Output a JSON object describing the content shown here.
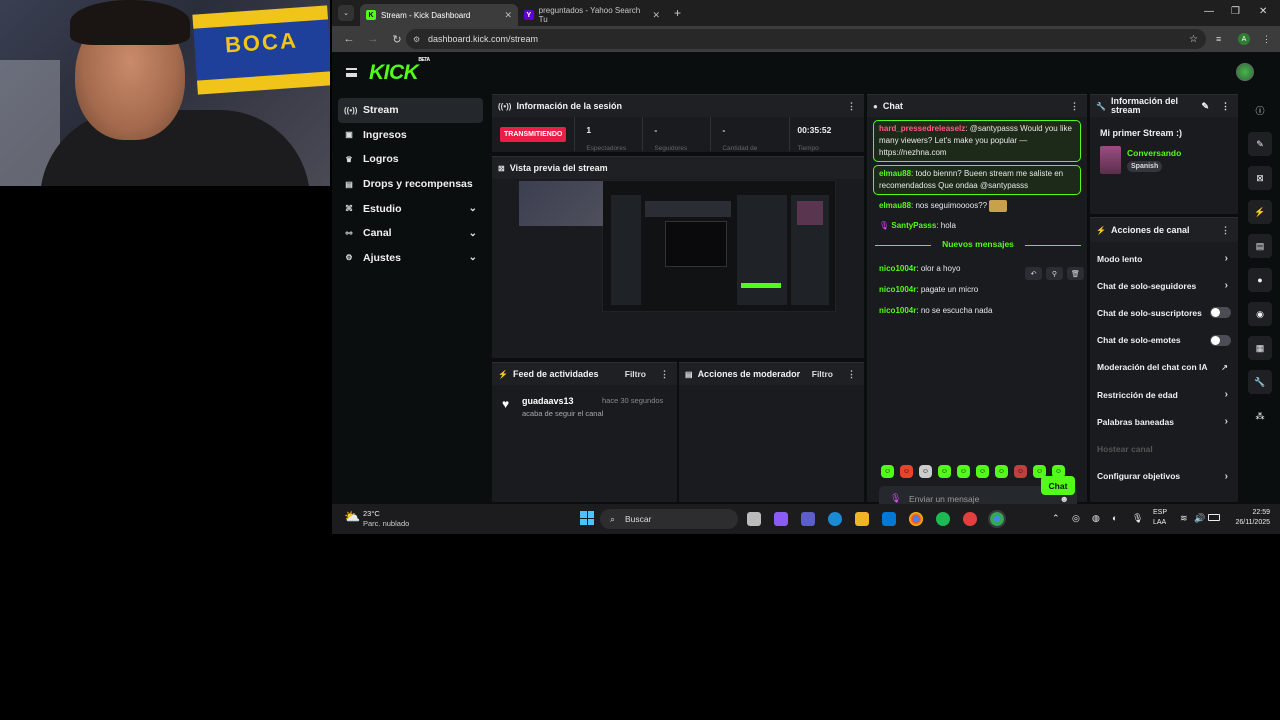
{
  "browser": {
    "tabs": [
      {
        "label": "Stream - Kick Dashboard",
        "icon": "kick-icon",
        "color": "#53fc18"
      },
      {
        "label": "preguntados - Yahoo Search Tu",
        "icon": "yahoo-icon",
        "color": "#6001d2"
      }
    ],
    "url": "dashboard.kick.com/stream",
    "profile_initial": "A"
  },
  "kick": {
    "logo": "KICK",
    "logo_badge": "BETA",
    "accent": "#53fc18",
    "sidebar": [
      {
        "label": "Stream",
        "icon": "broadcast-icon",
        "active": true
      },
      {
        "label": "Ingresos",
        "icon": "money-icon"
      },
      {
        "label": "Logros",
        "icon": "trophy-icon"
      },
      {
        "label": "Drops y recompensas",
        "icon": "gift-icon"
      },
      {
        "label": "Estudio",
        "icon": "studio-icon",
        "expandable": true
      },
      {
        "label": "Canal",
        "icon": "channel-icon",
        "expandable": true
      },
      {
        "label": "Ajustes",
        "icon": "gear-icon",
        "expandable": true
      }
    ],
    "session": {
      "title": "Información de la sesión",
      "live_label": "TRANSMITIENDO",
      "stats": [
        {
          "value": "1",
          "label": "Espectadores"
        },
        {
          "value": "-",
          "label": "Seguidores"
        },
        {
          "value": "-",
          "label": "Cantidad de"
        },
        {
          "value": "00:35:52",
          "label": "Tiempo"
        }
      ]
    },
    "preview_title": "Vista previa del stream",
    "activity": {
      "title": "Feed de actividades",
      "filter": "Filtro",
      "items": [
        {
          "user": "guadaavs13",
          "time": "hace 30 segundos",
          "text": "acaba de seguir el canal"
        }
      ]
    },
    "moderator": {
      "title": "Acciones de moderador",
      "filter": "Filtro"
    },
    "chat": {
      "title": "Chat",
      "messages": [
        {
          "user": "hard_pressedreleaselz",
          "text": "@santypasss Would you like many viewers? Let's make you popular — https://nezhna.com",
          "color": "#ff5b8a",
          "highlight": true
        },
        {
          "user": "elmau88",
          "text": "todo biennn? Bueen stream me saliste en recomendadoss Que ondaa @santypasss",
          "color": "#53fc18",
          "highlight": true
        },
        {
          "user": "elmau88",
          "text": "nos seguimoooos??",
          "color": "#53fc18"
        },
        {
          "user": "SantyPasss",
          "text": "hola",
          "color": "#53fc18"
        }
      ],
      "new_messages_label": "Nuevos mensajes",
      "new_messages": [
        {
          "user": "nico1004r",
          "text": "olor a hoyo"
        },
        {
          "user": "nico1004r",
          "text": "pagate un micro"
        },
        {
          "user": "nico1004r",
          "text": "no se escucha nada"
        }
      ],
      "input_placeholder": "Enviar un mensaje",
      "send_label": "Chat"
    },
    "stream_info": {
      "title": "Información del stream",
      "stream_title": "Mi primer Stream :)",
      "category": "Conversando",
      "language": "Spanish"
    },
    "channel_actions": {
      "title": "Acciones de canal",
      "items": [
        {
          "label": "Modo lento",
          "type": "chevron"
        },
        {
          "label": "Chat de solo-seguidores",
          "type": "chevron"
        },
        {
          "label": "Chat de solo-suscriptores",
          "type": "toggle"
        },
        {
          "label": "Chat de solo-emotes",
          "type": "toggle"
        },
        {
          "label": "Moderación del chat con IA",
          "type": "external"
        },
        {
          "label": "Restricción de edad",
          "type": "chevron"
        },
        {
          "label": "Palabras baneadas",
          "type": "chevron"
        },
        {
          "label": "Hostear canal",
          "type": "disabled"
        },
        {
          "label": "Configurar objetivos",
          "type": "chevron"
        }
      ]
    }
  },
  "taskbar": {
    "weather_temp": "23°C",
    "weather_text": "Parc. nublado",
    "search_label": "Buscar",
    "lang_top": "ESP",
    "lang_bottom": "LAA",
    "time": "22:59",
    "date": "26/11/2025"
  },
  "webcam_banner": "BOCA"
}
